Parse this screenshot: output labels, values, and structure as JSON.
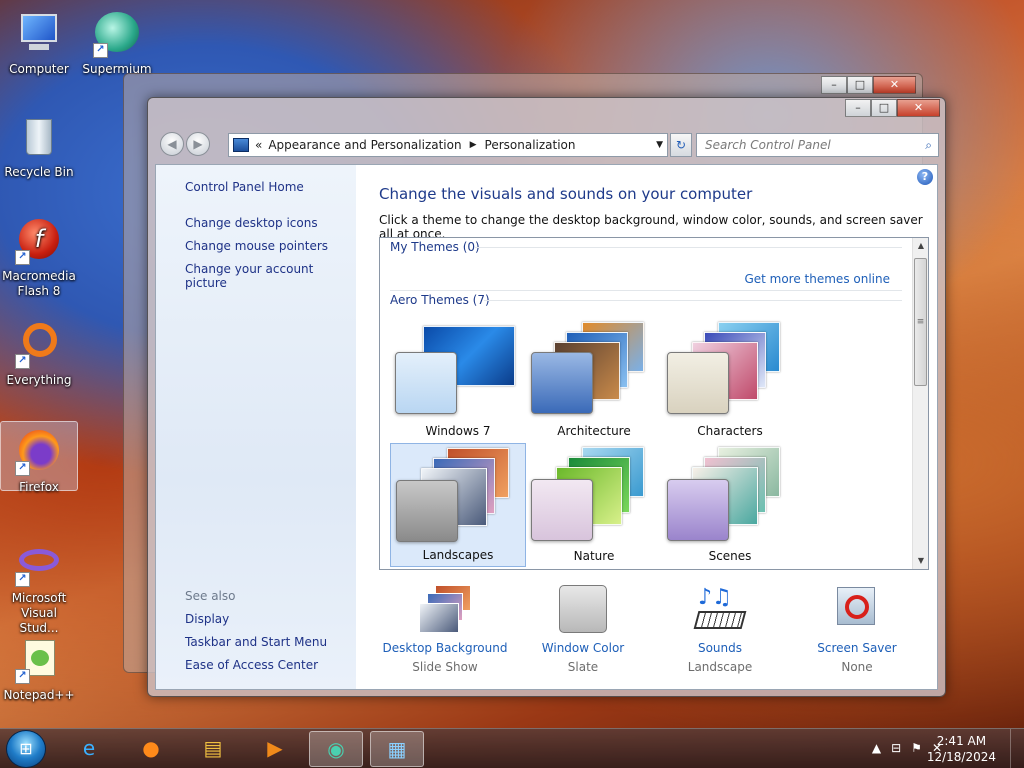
{
  "desktop": {
    "icons": [
      {
        "label": "Computer"
      },
      {
        "label": "Supermium"
      },
      {
        "label": "Recycle Bin"
      },
      {
        "label": "Macromedia Flash 8"
      },
      {
        "label": "Everything"
      },
      {
        "label": "Firefox"
      },
      {
        "label": "Microsoft Visual Stud..."
      },
      {
        "label": "Notepad++"
      }
    ]
  },
  "window": {
    "address": {
      "back_glyph": "«",
      "crumbs": [
        "Appearance and Personalization",
        "Personalization"
      ]
    },
    "search_placeholder": "Search Control Panel",
    "left_pane": {
      "links": [
        "Control Panel Home",
        "Change desktop icons",
        "Change mouse pointers",
        "Change your account picture"
      ],
      "see_also_label": "See also",
      "see_also": [
        "Display",
        "Taskbar and Start Menu",
        "Ease of Access Center"
      ]
    },
    "main": {
      "title": "Change the visuals and sounds on your computer",
      "description": "Click a theme to change the desktop background, window color, sounds, and screen saver all at once.",
      "my_themes_label": "My Themes (0)",
      "get_more_link": "Get more themes online",
      "aero_themes_label": "Aero Themes (7)",
      "themes": [
        {
          "label": "Windows 7",
          "selected": false
        },
        {
          "label": "Architecture",
          "selected": false
        },
        {
          "label": "Characters",
          "selected": false
        },
        {
          "label": "Landscapes",
          "selected": true
        },
        {
          "label": "Nature",
          "selected": false
        },
        {
          "label": "Scenes",
          "selected": false
        }
      ],
      "bottom": [
        {
          "title": "Desktop Background",
          "subtitle": "Slide Show"
        },
        {
          "title": "Window Color",
          "subtitle": "Slate"
        },
        {
          "title": "Sounds",
          "subtitle": "Landscape"
        },
        {
          "title": "Screen Saver",
          "subtitle": "None"
        }
      ]
    }
  },
  "taskbar": {
    "clock_time": "2:41 AM",
    "clock_date": "12/18/2024"
  },
  "colors": {
    "link": "#1e5fb8",
    "title": "#1e3a8a",
    "selected_theme_bg": "#dbe9fa"
  }
}
